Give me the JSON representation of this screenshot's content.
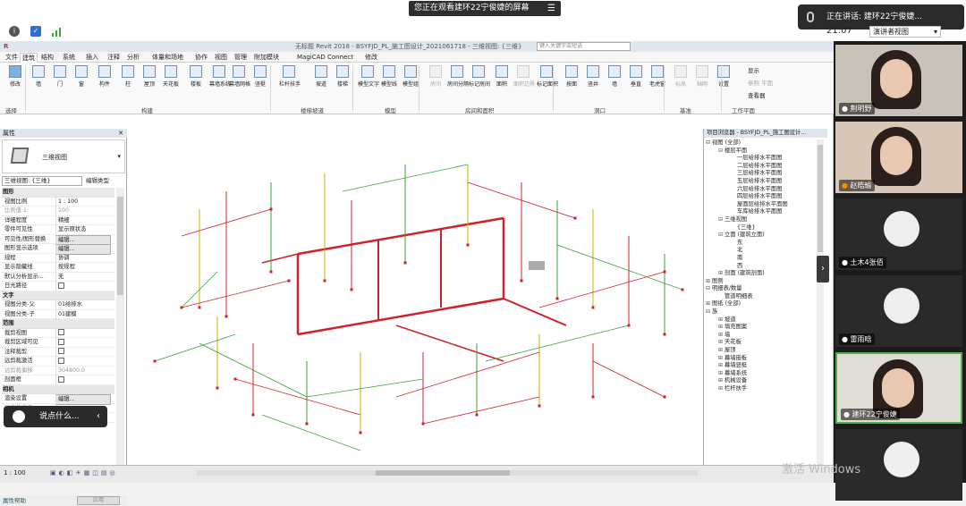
{
  "meeting": {
    "share_banner": "您正在观看建环22宁俊婕的屏幕",
    "speaker_text": "正在讲话: 建环22宁俊婕...",
    "time": "21:07",
    "view_mode": "演讲者视图",
    "watermark": "激活 Windows"
  },
  "app": {
    "title": "无标题 Revit 2018 - BSYFJD_PL_施工图设计_2021061718 - 三维视图: {三维}",
    "search_placeholder": "键入关键字或短语",
    "menus": [
      "文件",
      "建筑",
      "结构",
      "系统",
      "插入",
      "注释",
      "分析",
      "体量和场地",
      "协作",
      "视图",
      "管理",
      "附加模块",
      "MagiCAD Connect",
      "修改"
    ],
    "active_menu": "建筑"
  },
  "ribbon": {
    "buttons": [
      {
        "label": "修改",
        "icon": "cursor-icon",
        "active": true
      },
      {
        "label": "墙",
        "icon": "wall-icon"
      },
      {
        "label": "门",
        "icon": "door-icon"
      },
      {
        "label": "窗",
        "icon": "window-icon"
      },
      {
        "label": "构件",
        "icon": "component-icon"
      },
      {
        "label": "柱",
        "icon": "column-icon"
      },
      {
        "label": "屋顶",
        "icon": "roof-icon"
      },
      {
        "label": "天花板",
        "icon": "ceiling-icon"
      },
      {
        "label": "楼板",
        "icon": "floor-icon"
      },
      {
        "label": "幕墙系统",
        "icon": "curtain-system-icon"
      },
      {
        "label": "幕墙网格",
        "icon": "curtain-grid-icon"
      },
      {
        "label": "竖梃",
        "icon": "mullion-icon"
      },
      {
        "label": "栏杆扶手",
        "icon": "railing-icon"
      },
      {
        "label": "坡道",
        "icon": "ramp-icon"
      },
      {
        "label": "楼梯",
        "icon": "stair-icon"
      },
      {
        "label": "模型文字",
        "icon": "model-text-icon"
      },
      {
        "label": "模型线",
        "icon": "model-line-icon"
      },
      {
        "label": "模型组",
        "icon": "model-group-icon"
      },
      {
        "label": "房间",
        "icon": "room-icon",
        "dim": true
      },
      {
        "label": "房间分隔",
        "icon": "room-separator-icon"
      },
      {
        "label": "标记房间",
        "icon": "tag-room-icon"
      },
      {
        "label": "面积",
        "icon": "area-icon"
      },
      {
        "label": "面积边界",
        "icon": "area-boundary-icon",
        "dim": true
      },
      {
        "label": "标记面积",
        "icon": "tag-area-icon"
      },
      {
        "label": "按面",
        "icon": "by-face-icon"
      },
      {
        "label": "竖井",
        "icon": "shaft-icon"
      },
      {
        "label": "墙",
        "icon": "opening-wall-icon"
      },
      {
        "label": "垂直",
        "icon": "vertical-icon"
      },
      {
        "label": "老虎窗",
        "icon": "dormer-icon"
      },
      {
        "label": "标高",
        "icon": "level-icon",
        "dim": true
      },
      {
        "label": "轴网",
        "icon": "grid-icon",
        "dim": true
      },
      {
        "label": "设置",
        "icon": "set-icon"
      }
    ],
    "small_buttons": [
      "显示",
      "参照 平面",
      "查看器"
    ],
    "groups": [
      "选择",
      "构建",
      "楼梯坡道",
      "模型",
      "房间和面积",
      "洞口",
      "基准",
      "工作平面"
    ]
  },
  "properties": {
    "header": "属性",
    "type_name": "三维视图",
    "view_selector": "三维视图: {三维}",
    "edit_type": "编辑类型",
    "rows": [
      {
        "k": "图形",
        "sec": true
      },
      {
        "k": "视图比例",
        "v": "1 : 100"
      },
      {
        "k": "比例值 1:",
        "v": "100",
        "dis": true
      },
      {
        "k": "详细程度",
        "v": "精细"
      },
      {
        "k": "零件可见性",
        "v": "显示原状态"
      },
      {
        "k": "可见性/图形替换",
        "v": "编辑...",
        "btn": true
      },
      {
        "k": "图形显示选项",
        "v": "编辑...",
        "btn": true
      },
      {
        "k": "规程",
        "v": "协调"
      },
      {
        "k": "显示隐藏线",
        "v": "按规程"
      },
      {
        "k": "默认分析显示...",
        "v": "无"
      },
      {
        "k": "日光路径",
        "v": "",
        "cb": true
      },
      {
        "k": "文字",
        "sec": true
      },
      {
        "k": "视图分类-父",
        "v": "01给排水"
      },
      {
        "k": "视图分类-子",
        "v": "01建模"
      },
      {
        "k": "范围",
        "sec": true
      },
      {
        "k": "裁剪视图",
        "v": "",
        "cb": true
      },
      {
        "k": "裁剪区域可见",
        "v": "",
        "cb": true
      },
      {
        "k": "注释裁剪",
        "v": "",
        "cb": true
      },
      {
        "k": "远剪裁激活",
        "v": "",
        "cb": true
      },
      {
        "k": "远剪裁偏移",
        "v": "304800.0",
        "dis": true
      },
      {
        "k": "剖面框",
        "v": "",
        "cb": true
      },
      {
        "k": "相机",
        "sec": true
      },
      {
        "k": "渲染设置",
        "v": "编辑...",
        "btn": true
      },
      {
        "k": "锁定的方向",
        "v": "",
        "dis": true
      },
      {
        "k": "透视图",
        "v": "",
        "dis": true
      }
    ],
    "footer": "属性帮助",
    "apply": "应用"
  },
  "chat": {
    "placeholder": "说点什么..."
  },
  "browser": {
    "header": "项目浏览器 - BSYFJD_PL_施工图设计...",
    "nodes": [
      {
        "t": "视图 (全部)",
        "lv": 0,
        "tg": "⊟"
      },
      {
        "t": "楼层平面",
        "lv": 1,
        "tg": "⊟"
      },
      {
        "t": "一层给排水平面图",
        "lv": 2
      },
      {
        "t": "二层给排水平面图",
        "lv": 2
      },
      {
        "t": "三层给排水平面图",
        "lv": 2
      },
      {
        "t": "五层给排水平面图",
        "lv": 2
      },
      {
        "t": "六层给排水平面图",
        "lv": 2
      },
      {
        "t": "四层给排水平面图",
        "lv": 2
      },
      {
        "t": "屋面层给排水平面图",
        "lv": 2
      },
      {
        "t": "车库给排水平面图",
        "lv": 2
      },
      {
        "t": "三维视图",
        "lv": 1,
        "tg": "⊟"
      },
      {
        "t": "{三维}",
        "lv": 2
      },
      {
        "t": "立面 (建筑立面)",
        "lv": 1,
        "tg": "⊟"
      },
      {
        "t": "东",
        "lv": 2
      },
      {
        "t": "北",
        "lv": 2
      },
      {
        "t": "南",
        "lv": 2
      },
      {
        "t": "西",
        "lv": 2
      },
      {
        "t": "剖面 (建筑剖面)",
        "lv": 1,
        "tg": "⊞"
      },
      {
        "t": "图例",
        "lv": 0,
        "tg": "⊞"
      },
      {
        "t": "明细表/数量",
        "lv": 0,
        "tg": "⊟"
      },
      {
        "t": "管道明细表",
        "lv": 1
      },
      {
        "t": "图纸 (全部)",
        "lv": 0,
        "tg": "⊞"
      },
      {
        "t": "族",
        "lv": 0,
        "tg": "⊟"
      },
      {
        "t": "坡道",
        "lv": 1,
        "tg": "⊞"
      },
      {
        "t": "填充图案",
        "lv": 1,
        "tg": "⊞"
      },
      {
        "t": "墙",
        "lv": 1,
        "tg": "⊞"
      },
      {
        "t": "天花板",
        "lv": 1,
        "tg": "⊞"
      },
      {
        "t": "屋顶",
        "lv": 1,
        "tg": "⊞"
      },
      {
        "t": "幕墙嵌板",
        "lv": 1,
        "tg": "⊞"
      },
      {
        "t": "幕墙竖梃",
        "lv": 1,
        "tg": "⊞"
      },
      {
        "t": "幕墙系统",
        "lv": 1,
        "tg": "⊞"
      },
      {
        "t": "机械设备",
        "lv": 1,
        "tg": "⊞"
      },
      {
        "t": "栏杆扶手",
        "lv": 1,
        "tg": "⊞"
      }
    ]
  },
  "status": {
    "scale": "1 : 100"
  },
  "participants": [
    {
      "name": "荆明野",
      "type": "photo",
      "bg": "#c9c2b9",
      "mic": "on"
    },
    {
      "name": "赵皓瑜",
      "type": "photo",
      "bg": "#d8c6b7",
      "mic": "orange"
    },
    {
      "name": "土木4张佰",
      "type": "avatar",
      "bg": "#2a2a2a",
      "mic": "off"
    },
    {
      "name": "雷雨晗",
      "type": "avatar",
      "bg": "#2a2a2a",
      "mic": "off"
    },
    {
      "name": "建环22宁俊婕",
      "type": "photo",
      "bg": "#e0ddd6",
      "mic": "on",
      "active": true
    },
    {
      "name": "",
      "type": "avatar",
      "bg": "#2a2a2a",
      "mic": "off"
    }
  ],
  "colors": {
    "pipe_red": "#d0202a",
    "pipe_green": "#3aa03a",
    "pipe_yellow": "#c8b400",
    "accent": "#4bb04b"
  }
}
